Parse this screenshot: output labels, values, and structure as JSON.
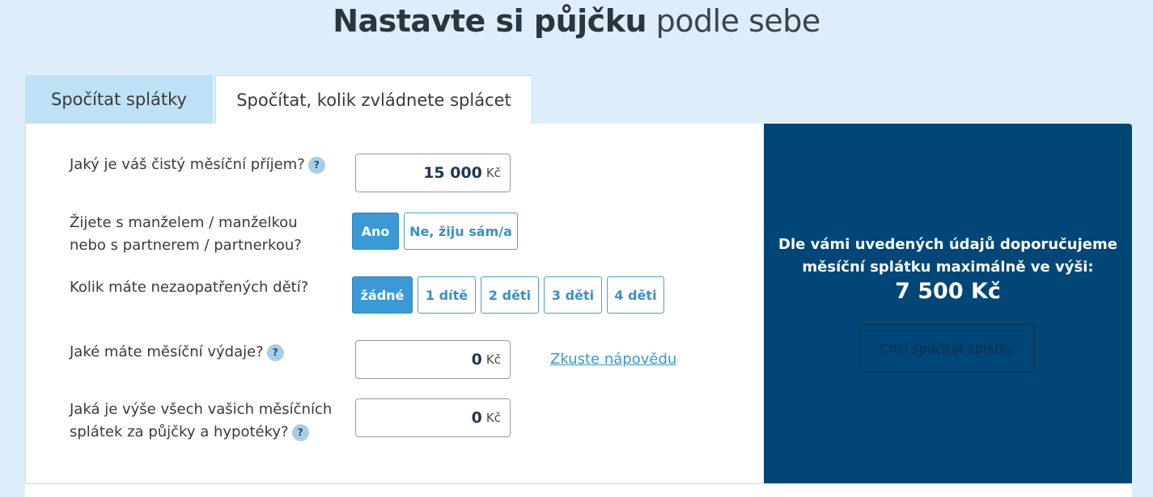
{
  "title": {
    "strong": "Nastavte si půjčku",
    "light": "podle sebe"
  },
  "tabs": [
    {
      "label": "Spočítat splátky",
      "active": false
    },
    {
      "label": "Spočítat, kolik zvládnete splácet",
      "active": true
    }
  ],
  "form": {
    "income": {
      "label": "Jaký je váš čistý měsíční příjem?",
      "value": "15 000",
      "unit": "Kč",
      "help": "?"
    },
    "partner": {
      "label_line1": "Žijete s manželem / manželkou",
      "label_line2": "nebo s partnerem / partnerkou?",
      "options": [
        {
          "label": "Ano",
          "selected": true
        },
        {
          "label": "Ne, žiju sám/a",
          "selected": false
        }
      ]
    },
    "children": {
      "label": "Kolik máte nezaopatřených dětí?",
      "options": [
        {
          "label": "žádné",
          "selected": true
        },
        {
          "label": "1 dítě",
          "selected": false
        },
        {
          "label": "2 děti",
          "selected": false
        },
        {
          "label": "3 děti",
          "selected": false
        },
        {
          "label": "4 děti",
          "selected": false
        }
      ]
    },
    "expenses": {
      "label": "Jaké máte měsíční výdaje?",
      "value": "0",
      "unit": "Kč",
      "help": "?",
      "link": "Zkuste nápovědu"
    },
    "installments": {
      "label_line1": "Jaká je výše všech vašich měsíčních",
      "label_line2": "splátek za půjčky a hypotéky?",
      "value": "0",
      "unit": "Kč",
      "help": "?"
    }
  },
  "result": {
    "text_line1": "Dle vámi uvedených údajů doporučujeme",
    "text_line2": "měsíční splátku maximálně ve výši:",
    "amount": "7 500 Kč",
    "button": "Chci spočítat splátky"
  },
  "colors": {
    "accent": "#3b9ad6",
    "panel_dark": "#004677",
    "page_bg": "#ddeefa"
  }
}
